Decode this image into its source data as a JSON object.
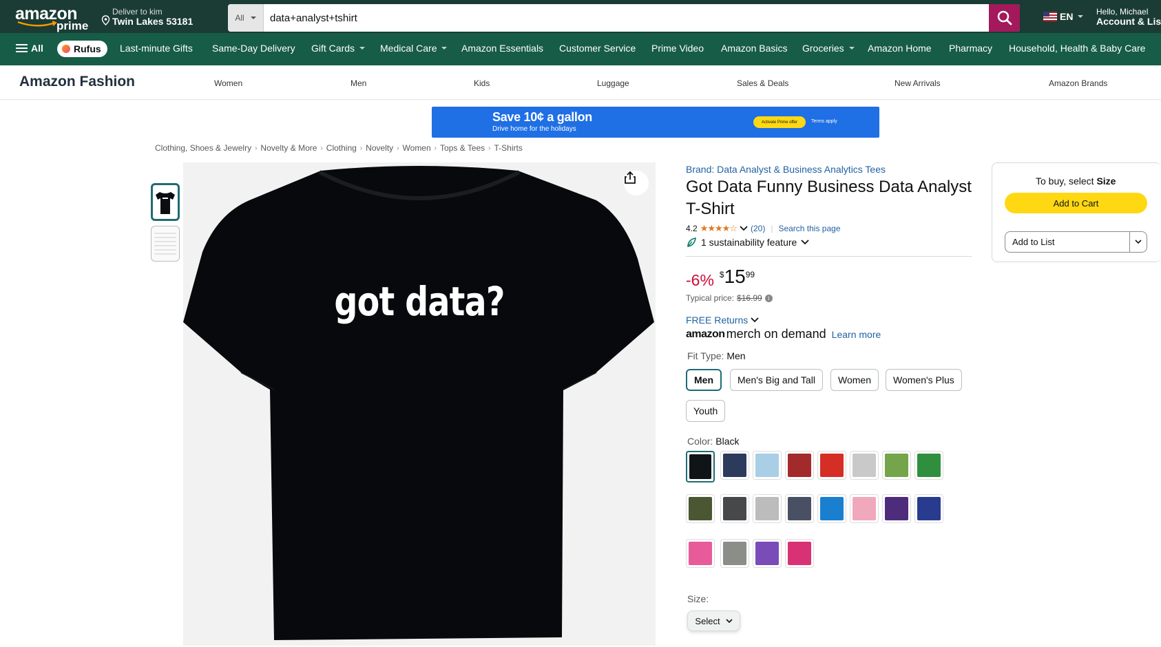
{
  "header": {
    "logo_text": "amazon",
    "logo_sub": "prime",
    "deliver_line1": "Deliver to kim",
    "deliver_line2": "Twin Lakes 53181",
    "search_dept": "All",
    "search_value": "data+analyst+tshirt",
    "lang": "EN",
    "account_line1": "Hello, Michael",
    "account_line2": "Account & Lists"
  },
  "nav": {
    "all": "All",
    "rufus": "Rufus",
    "items": [
      "Last-minute Gifts",
      "Same-Day Delivery",
      "Gift Cards",
      "Medical Care",
      "Amazon Essentials",
      "Customer Service",
      "Prime Video",
      "Amazon Basics",
      "Groceries",
      "Amazon Home",
      "Pharmacy",
      "Household, Health & Baby Care"
    ]
  },
  "fashion": {
    "brand": "Amazon Fashion",
    "links": [
      "Women",
      "Men",
      "Kids",
      "Luggage",
      "Sales & Deals",
      "New Arrivals",
      "Amazon Brands"
    ]
  },
  "banner": {
    "headline": "Save 10¢ a gallon",
    "sub": "Drive home for the holidays",
    "cta": "Activate Prime offer",
    "terms": "Terms apply"
  },
  "breadcrumbs": [
    "Clothing, Shoes & Jewelry",
    "Novelty & More",
    "Clothing",
    "Novelty",
    "Women",
    "Tops & Tees",
    "T-Shirts"
  ],
  "product": {
    "image_text": "got data?",
    "brand_link": "Brand: Data Analyst & Business Analytics Tees",
    "title": "Got Data Funny Business Data Analyst T-Shirt",
    "rating": "4.2",
    "stars": "★★★★☆",
    "review_count": "(20)",
    "search_page": "Search this page",
    "sustainability": "1 sustainability feature",
    "discount": "-6%",
    "currency": "$",
    "price_whole": "15",
    "price_frac": "99",
    "typical_label": "Typical price:",
    "typical_price": "$16.99",
    "free_returns": "FREE Returns",
    "merch_logo": "amazon",
    "merch_text": "merch on demand",
    "learn_more": "Learn more",
    "fit_label": "Fit Type:",
    "fit_value": "Men",
    "fit_options": [
      "Men",
      "Men's Big and Tall",
      "Women",
      "Women's Plus",
      "Youth"
    ],
    "color_label": "Color:",
    "color_value": "Black",
    "swatches": [
      "#0f1419",
      "#2c3a5c",
      "#a8cfe6",
      "#a32a2a",
      "#d52f25",
      "#c9c9c9",
      "#74a54a",
      "#2f8f3e",
      "#4b5633",
      "#46484a",
      "#bcbcbc",
      "#4a5063",
      "#1b7fcf",
      "#f0a8bd",
      "#4e2c7c",
      "#283b8f",
      "#e85b9a",
      "#8a8d88",
      "#7a4cb8",
      "#d93274"
    ],
    "size_label": "Size:",
    "size_select": "Select"
  },
  "buybox": {
    "to_buy": "To buy, select",
    "to_buy_bold": "Size",
    "add_to_cart": "Add to Cart",
    "add_to_list": "Add to List"
  },
  "colors": {
    "header_bg": "#1a3c34",
    "nav_bg": "#175c46",
    "search_btn": "#a3195b",
    "cart_btn": "#ffd814",
    "link": "#2162a1",
    "discount": "#cc0c39"
  }
}
